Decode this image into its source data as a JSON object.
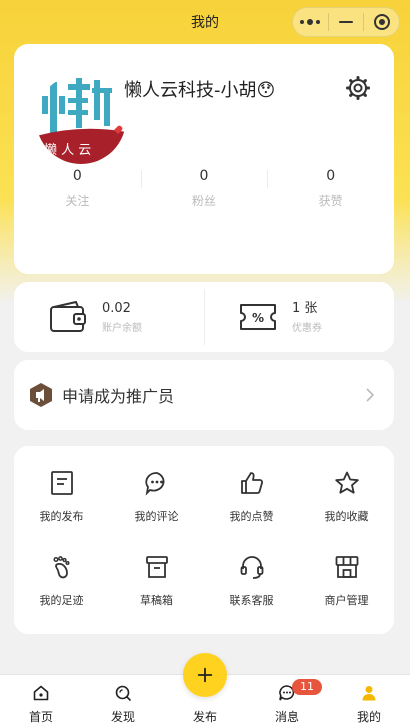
{
  "navbar": {
    "title": "我的",
    "capsule_icons": [
      "more-dots-icon",
      "minimize-icon",
      "close-target-icon"
    ]
  },
  "profile": {
    "username": "懒人云科技-小胡😯",
    "avatar_text": "懒人云",
    "stats": [
      {
        "value": "0",
        "label": "关注"
      },
      {
        "value": "0",
        "label": "粉丝"
      },
      {
        "value": "0",
        "label": "获赞"
      }
    ]
  },
  "wallet": {
    "balance_value": "0.02",
    "balance_label": "账户余额",
    "coupon_value": "1 张",
    "coupon_label": "优惠券"
  },
  "promo": {
    "label": "申请成为推广员"
  },
  "menu": [
    {
      "label": "我的发布",
      "icon": "document-icon"
    },
    {
      "label": "我的评论",
      "icon": "comment-icon"
    },
    {
      "label": "我的点赞",
      "icon": "thumbs-up-icon"
    },
    {
      "label": "我的收藏",
      "icon": "star-icon"
    },
    {
      "label": "我的足迹",
      "icon": "footprint-icon"
    },
    {
      "label": "草稿箱",
      "icon": "draft-box-icon"
    },
    {
      "label": "联系客服",
      "icon": "headset-icon"
    },
    {
      "label": "商户管理",
      "icon": "store-icon"
    }
  ],
  "tabbar": {
    "tabs": [
      {
        "label": "首页",
        "icon": "home-icon"
      },
      {
        "label": "发现",
        "icon": "discover-icon"
      },
      {
        "label": "发布",
        "icon": "plus-icon"
      },
      {
        "label": "消息",
        "icon": "message-icon"
      },
      {
        "label": "我的",
        "icon": "user-icon"
      }
    ],
    "message_badge": "11"
  },
  "colors": {
    "accent_yellow": "#ffd21f",
    "badge_red": "#e8553d",
    "active_tab": "#f5b800"
  }
}
